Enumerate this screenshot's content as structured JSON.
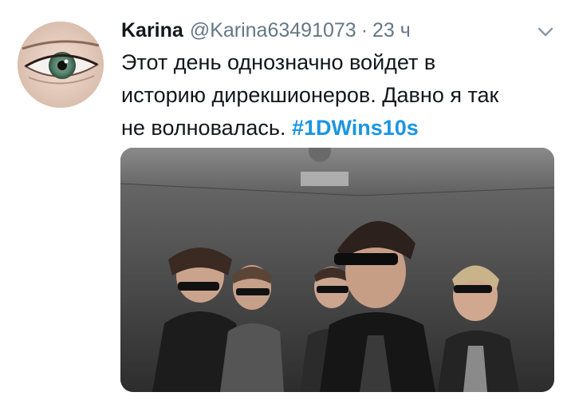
{
  "tweet": {
    "display_name": "Karina",
    "handle": "@Karina63491073",
    "separator": "·",
    "time": "23 ч",
    "text_line1": "Этот день однозначно войдет в",
    "text_line2": "историю дирекшионеров. Давно я так",
    "text_line3_prefix": "не волновалась. ",
    "hashtag": "#1DWins10s",
    "avatar_icon": "eye-avatar",
    "menu_icon": "chevron-down-icon",
    "media_description": "photo"
  },
  "colors": {
    "name": "#14171a",
    "secondary": "#657786",
    "hashtag": "#1b95e0",
    "background": "#ffffff"
  }
}
